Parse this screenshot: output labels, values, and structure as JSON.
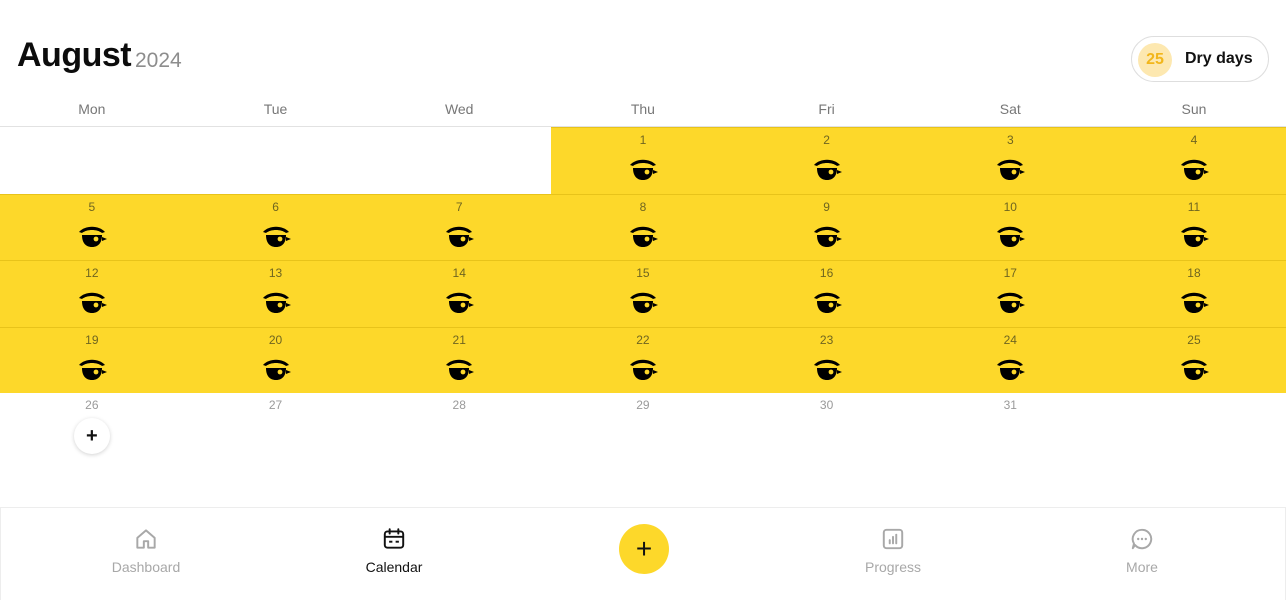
{
  "header": {
    "month": "August",
    "year": "2024"
  },
  "dry_days": {
    "count": "25",
    "label": "Dry days"
  },
  "weekdays": [
    "Mon",
    "Tue",
    "Wed",
    "Thu",
    "Fri",
    "Sat",
    "Sun"
  ],
  "calendar": {
    "weeks": [
      [
        {
          "day": ""
        },
        {
          "day": ""
        },
        {
          "day": ""
        },
        {
          "day": "1",
          "dry": true
        },
        {
          "day": "2",
          "dry": true
        },
        {
          "day": "3",
          "dry": true
        },
        {
          "day": "4",
          "dry": true
        }
      ],
      [
        {
          "day": "5",
          "dry": true
        },
        {
          "day": "6",
          "dry": true
        },
        {
          "day": "7",
          "dry": true
        },
        {
          "day": "8",
          "dry": true
        },
        {
          "day": "9",
          "dry": true
        },
        {
          "day": "10",
          "dry": true
        },
        {
          "day": "11",
          "dry": true
        }
      ],
      [
        {
          "day": "12",
          "dry": true
        },
        {
          "day": "13",
          "dry": true
        },
        {
          "day": "14",
          "dry": true
        },
        {
          "day": "15",
          "dry": true
        },
        {
          "day": "16",
          "dry": true
        },
        {
          "day": "17",
          "dry": true
        },
        {
          "day": "18",
          "dry": true
        }
      ],
      [
        {
          "day": "19",
          "dry": true
        },
        {
          "day": "20",
          "dry": true
        },
        {
          "day": "21",
          "dry": true
        },
        {
          "day": "22",
          "dry": true
        },
        {
          "day": "23",
          "dry": true
        },
        {
          "day": "24",
          "dry": true
        },
        {
          "day": "25",
          "dry": true
        }
      ],
      [
        {
          "day": "26",
          "add": true
        },
        {
          "day": "27"
        },
        {
          "day": "28"
        },
        {
          "day": "29"
        },
        {
          "day": "30"
        },
        {
          "day": "31"
        },
        {
          "day": ""
        }
      ]
    ],
    "dry_icon": "dry-day-cup-icon",
    "add_icon": "plus-icon"
  },
  "nav": {
    "dashboard": {
      "label": "Dashboard",
      "icon": "home-icon"
    },
    "calendar": {
      "label": "Calendar",
      "icon": "calendar-icon",
      "active": true
    },
    "add": {
      "icon": "plus-icon"
    },
    "progress": {
      "label": "Progress",
      "icon": "bar-chart-icon"
    },
    "more": {
      "label": "More",
      "icon": "chat-bubble-icon"
    }
  },
  "colors": {
    "accent": "#fdd82a",
    "dry_count_bg": "#fde8b0",
    "dry_count_text": "#f2b61b"
  }
}
